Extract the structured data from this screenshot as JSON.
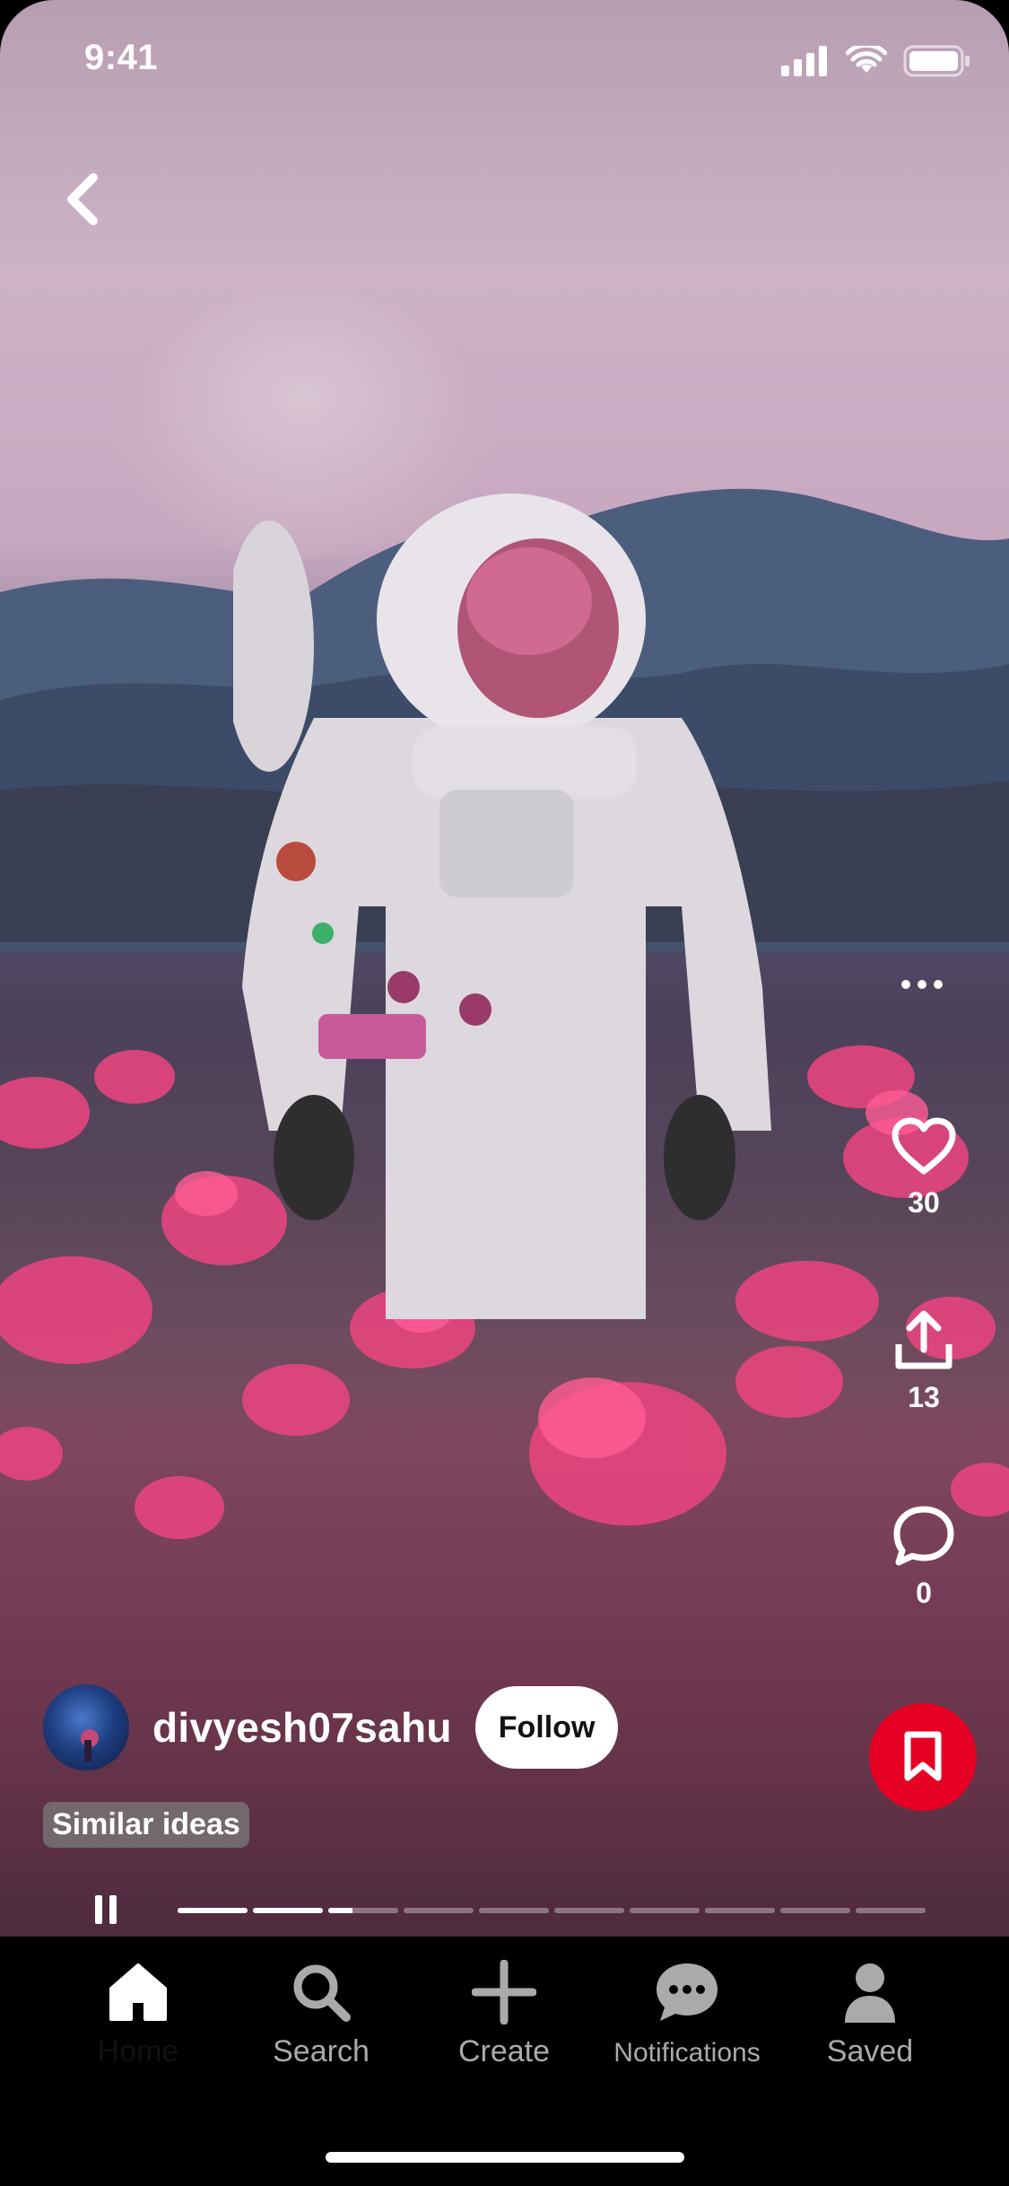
{
  "status_bar": {
    "time": "9:41"
  },
  "pin": {
    "creator": {
      "username": "divyesh07sahu",
      "follow_label": "Follow"
    },
    "similar_label": "Similar ideas",
    "actions": {
      "likes": "30",
      "shares": "13",
      "comments": "0"
    },
    "progress": {
      "segments": 10,
      "current_segment": 3,
      "current_fraction": 0.35
    }
  },
  "tabs": [
    {
      "label": "Home",
      "icon": "home-icon",
      "active": true
    },
    {
      "label": "Search",
      "icon": "search-icon"
    },
    {
      "label": "Create",
      "icon": "plus-icon"
    },
    {
      "label": "Notifications",
      "icon": "chat-bubble-icon"
    },
    {
      "label": "Saved",
      "icon": "person-icon"
    }
  ],
  "colors": {
    "save_button": "#e60023",
    "tab_inactive": "#aaaaaa"
  }
}
